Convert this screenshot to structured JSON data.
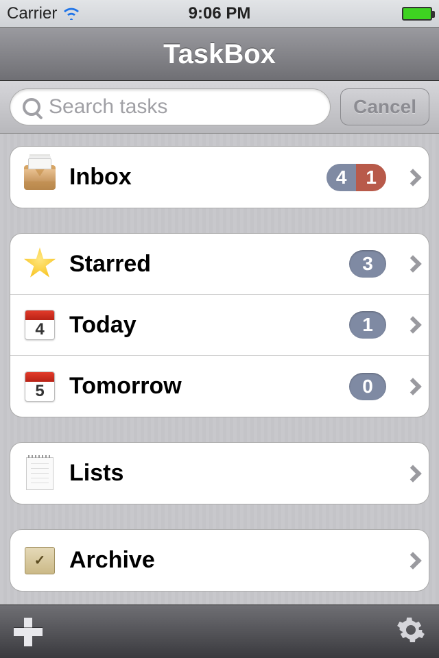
{
  "statusBar": {
    "carrier": "Carrier",
    "time": "9:06 PM"
  },
  "navBar": {
    "title": "TaskBox"
  },
  "searchBar": {
    "placeholder": "Search tasks",
    "cancel": "Cancel"
  },
  "groups": {
    "inbox": {
      "label": "Inbox",
      "badge_main": "4",
      "badge_alt": "1"
    },
    "starred": {
      "label": "Starred",
      "badge": "3"
    },
    "today": {
      "label": "Today",
      "badge": "1",
      "day": "4"
    },
    "tomorrow": {
      "label": "Tomorrow",
      "badge": "0",
      "day": "5"
    },
    "lists": {
      "label": "Lists"
    },
    "archive": {
      "label": "Archive"
    }
  }
}
